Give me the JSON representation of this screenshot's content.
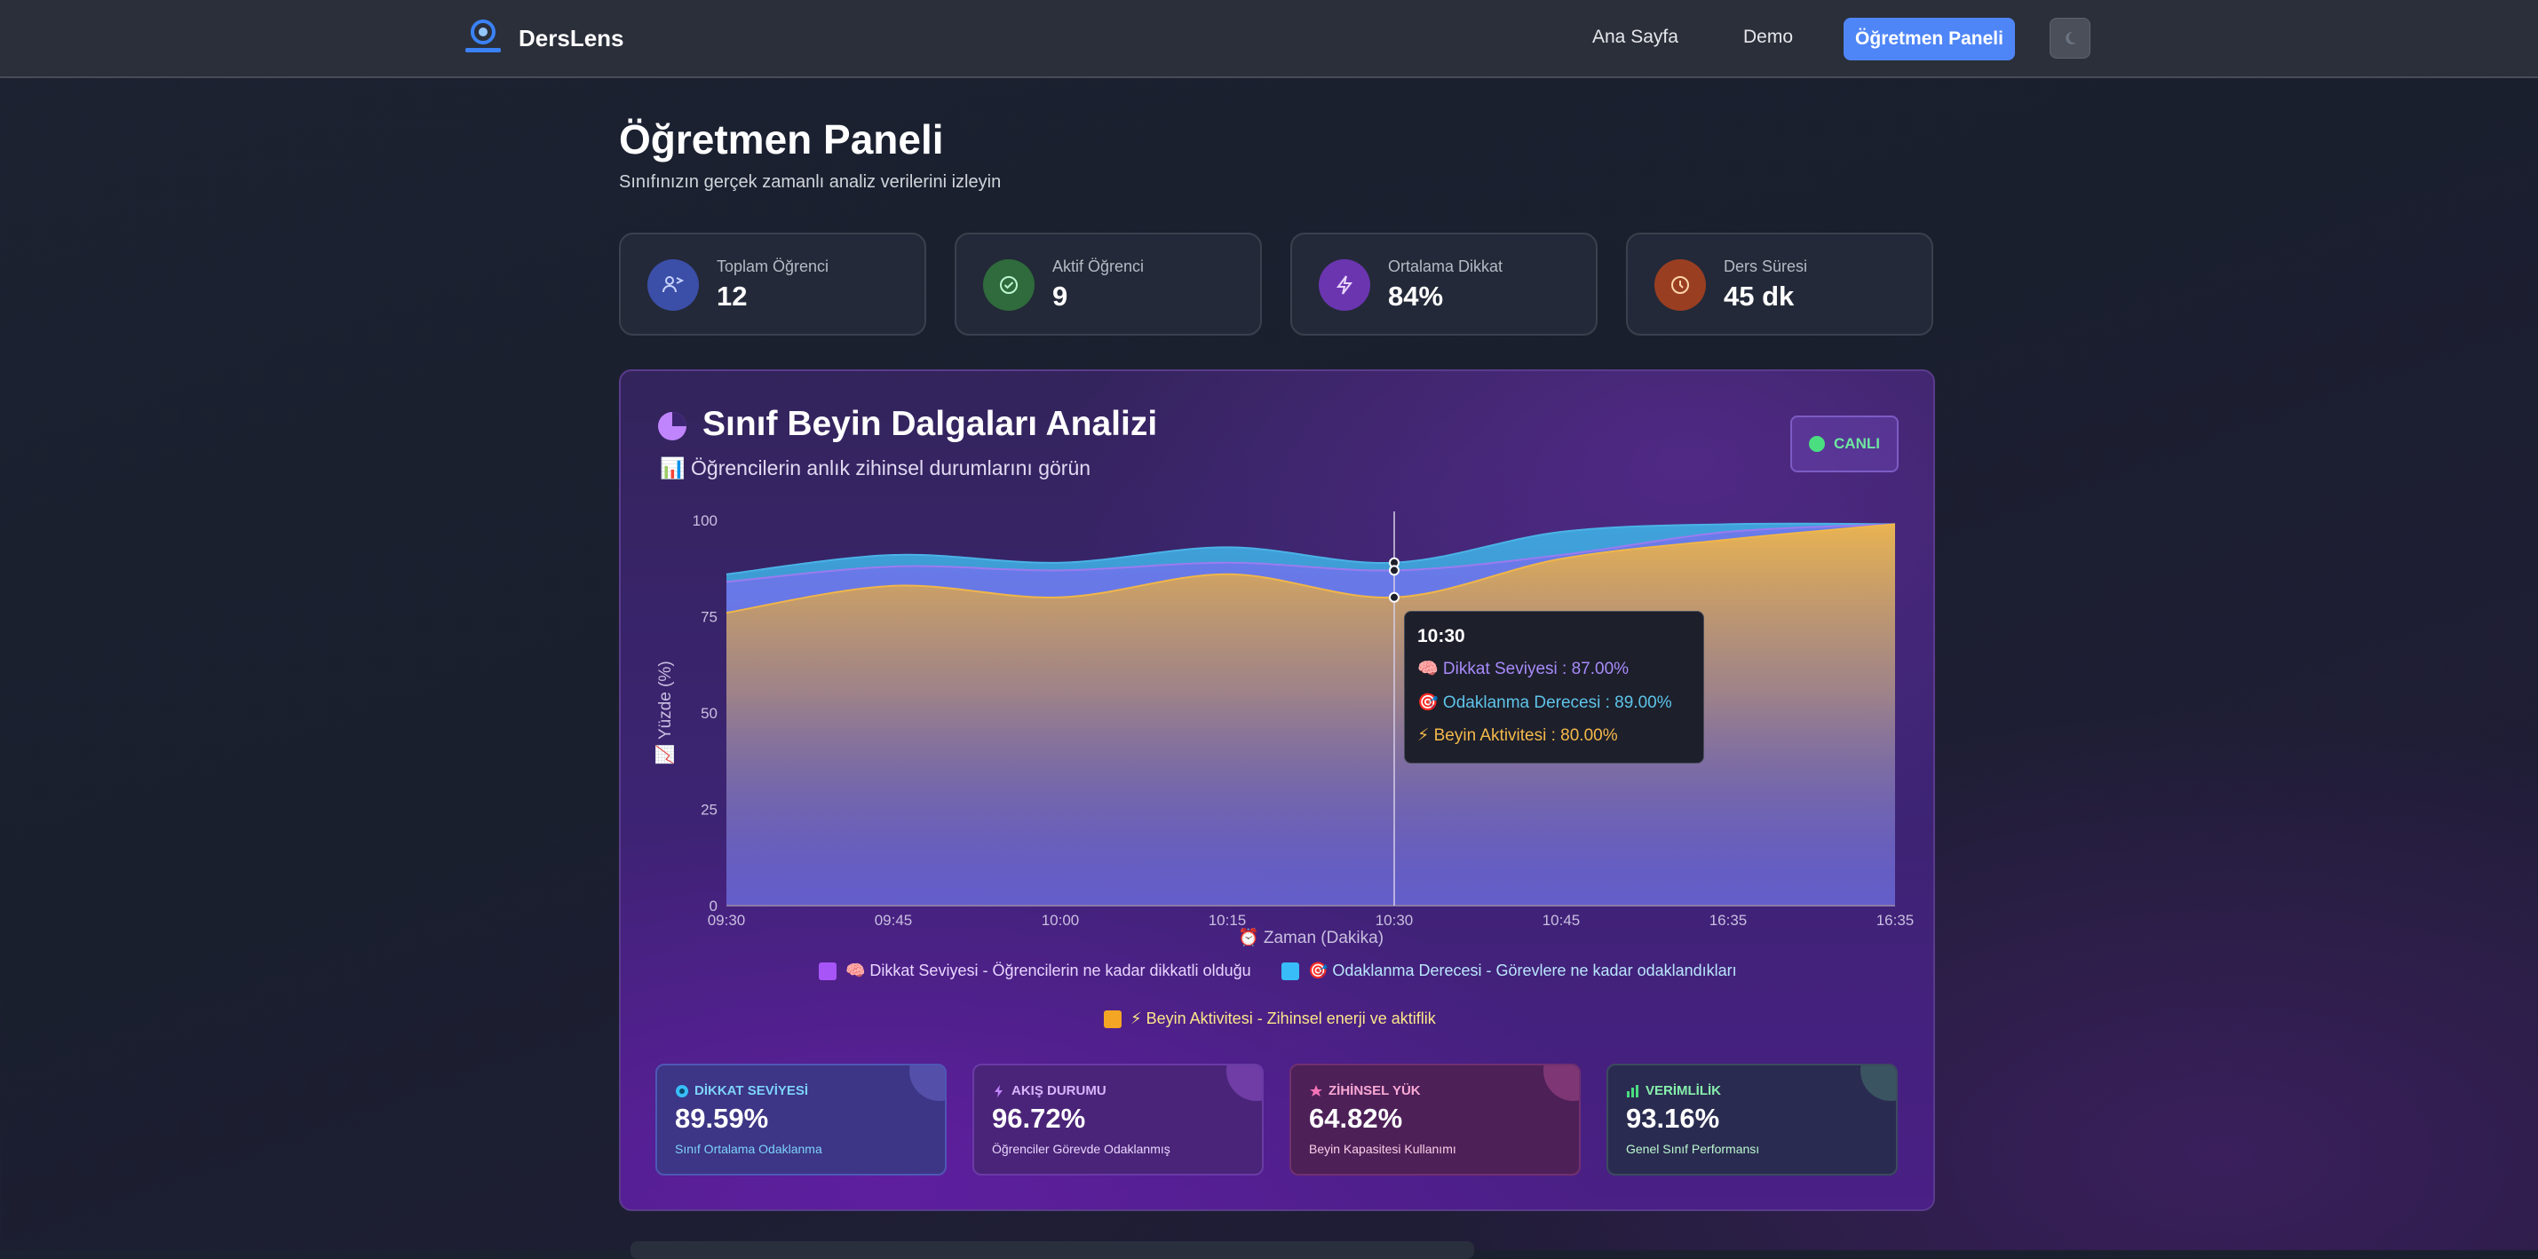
{
  "nav": {
    "brand": "DersLens",
    "links": [
      "Ana Sayfa",
      "Demo"
    ],
    "cta": "Öğretmen Paneli"
  },
  "header": {
    "title": "Öğretmen Paneli",
    "subtitle": "Sınıfınızın gerçek zamanlı analiz verilerini izleyin"
  },
  "stats": [
    {
      "label": "Toplam Öğrenci",
      "value": "12",
      "icon": "students-icon",
      "color": "#3b4fa8"
    },
    {
      "label": "Aktif Öğrenci",
      "value": "9",
      "icon": "check-circle-icon",
      "color": "#2f6b3c"
    },
    {
      "label": "Ortalama Dikkat",
      "value": "84%",
      "icon": "lightning-icon",
      "color": "#6b35b0"
    },
    {
      "label": "Ders Süresi",
      "value": "45 dk",
      "icon": "clock-icon",
      "color": "#9a3e22"
    }
  ],
  "panel": {
    "title": "Sınıf Beyin Dalgaları Analizi",
    "subtitle": "📊 Öğrencilerin anlık zihinsel durumlarını görün",
    "live_label": "CANLI"
  },
  "chart_data": {
    "type": "area",
    "x": [
      "09:30",
      "09:45",
      "10:00",
      "10:15",
      "10:30",
      "10:45",
      "16:35",
      "16:35"
    ],
    "xlabel": "⏰ Zaman (Dakika)",
    "ylabel": "📈 Yüzde (%)",
    "ylim": [
      0,
      100
    ],
    "yticks": [
      "0",
      "25",
      "50",
      "75",
      "100"
    ],
    "series": [
      {
        "name": "Dikkat Seviyesi",
        "color": "#8b5cf6",
        "values": [
          84,
          88,
          87,
          89,
          87,
          91,
          97,
          99
        ]
      },
      {
        "name": "Odaklanma Derecesi",
        "color": "#3fa9e0",
        "values": [
          86,
          91,
          89,
          93,
          89,
          97,
          99,
          99
        ]
      },
      {
        "name": "Beyin Aktivitesi",
        "color": "#f0b64a",
        "values": [
          76,
          83,
          80,
          86,
          80,
          90,
          95,
          99
        ]
      }
    ],
    "tooltip": {
      "title": "10:30",
      "lines": [
        {
          "text": "🧠 Dikkat Seviyesi : 87.00%",
          "color": "#a78bfa"
        },
        {
          "text": "🎯 Odaklanma Derecesi : 89.00%",
          "color": "#5ec4e8"
        },
        {
          "text": "⚡ Beyin Aktivitesi : 80.00%",
          "color": "#f5b94a"
        }
      ]
    },
    "legend": [
      {
        "text": "🧠 Dikkat Seviyesi - Öğrencilerin ne kadar dikkatli olduğu",
        "swatch": "#a855f7",
        "color": "#e9d5ff"
      },
      {
        "text": "🎯 Odaklanma Derecesi - Görevlere ne kadar odaklandıkları",
        "swatch": "#38bdf8",
        "color": "#bae6fd"
      },
      {
        "text": "⚡ Beyin Aktivitesi - Zihinsel enerji ve aktiflik",
        "swatch": "#f5a524",
        "color": "#fde68a"
      }
    ]
  },
  "metrics": [
    {
      "label": "DİKKAT SEVİYESİ",
      "value": "89.59%",
      "desc": "Sınıf Ortalama Odaklanma",
      "icon": "eye-icon",
      "accent": "#7dd3fc",
      "bg": "#3d3585",
      "border": "#4f57b5"
    },
    {
      "label": "AKIŞ DURUMU",
      "value": "96.72%",
      "desc": "Öğrenciler Görevde Odaklanmış",
      "icon": "lightning-icon",
      "accent": "#d8b4fe",
      "bg": "#4a2478",
      "border": "#6a3ba6"
    },
    {
      "label": "ZİHİNSEL YÜK",
      "value": "64.82%",
      "desc": "Beyin Kapasitesi Kullanımı",
      "icon": "star-icon",
      "accent": "#f9a8d4",
      "bg": "#4d2058",
      "border": "#71306f"
    },
    {
      "label": "VERİMLİLİK",
      "value": "93.16%",
      "desc": "Genel Sınıf Performansı",
      "icon": "chart-icon",
      "accent": "#86efac",
      "bg": "#2a2b50",
      "border": "#3b4b5e"
    }
  ]
}
